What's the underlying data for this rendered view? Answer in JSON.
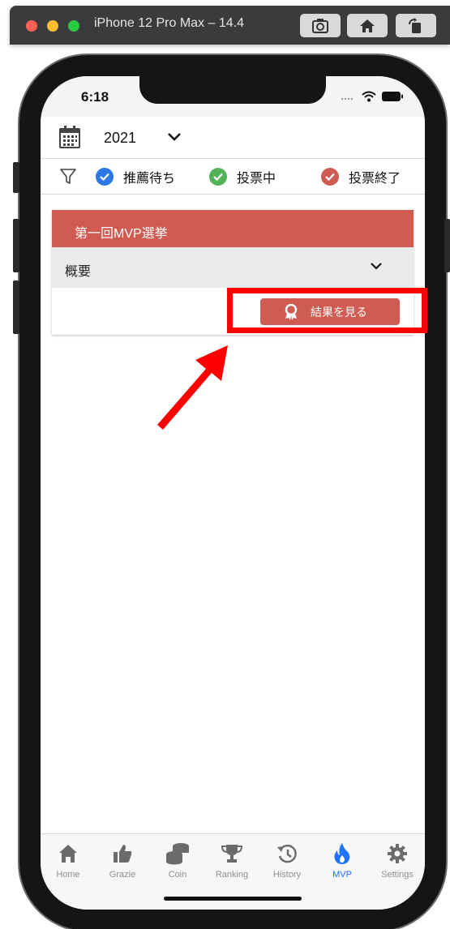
{
  "simulator": {
    "title": "iPhone 12 Pro Max – 14.4",
    "buttons": [
      "screenshot-icon",
      "home-icon",
      "rotate-icon"
    ]
  },
  "statusbar": {
    "time": "6:18",
    "icons": [
      "cellular-icon",
      "wifi-icon",
      "battery-icon"
    ]
  },
  "year_selector": {
    "value": "2021",
    "icon": "calendar-icon"
  },
  "filters": [
    {
      "label": "推薦待ち",
      "color": "#2b78e4"
    },
    {
      "label": "投票中",
      "color": "#52b35a"
    },
    {
      "label": "投票終了",
      "color": "#cf5b53"
    }
  ],
  "card": {
    "title": "第一回MVP選挙",
    "summary_label": "概要",
    "result_button": "結果を見る",
    "accent": "#cf5b53"
  },
  "tabs": [
    {
      "label": "Home",
      "icon": "home-icon"
    },
    {
      "label": "Grazie",
      "icon": "thumbs-up-icon"
    },
    {
      "label": "Coin",
      "icon": "coins-icon"
    },
    {
      "label": "Ranking",
      "icon": "trophy-icon"
    },
    {
      "label": "History",
      "icon": "history-icon"
    },
    {
      "label": "MVP",
      "icon": "fire-icon",
      "active": true
    },
    {
      "label": "Settings",
      "icon": "gear-icon"
    }
  ],
  "colors": {
    "active_tab": "#1e73ff",
    "annotation": "#ff0000"
  }
}
